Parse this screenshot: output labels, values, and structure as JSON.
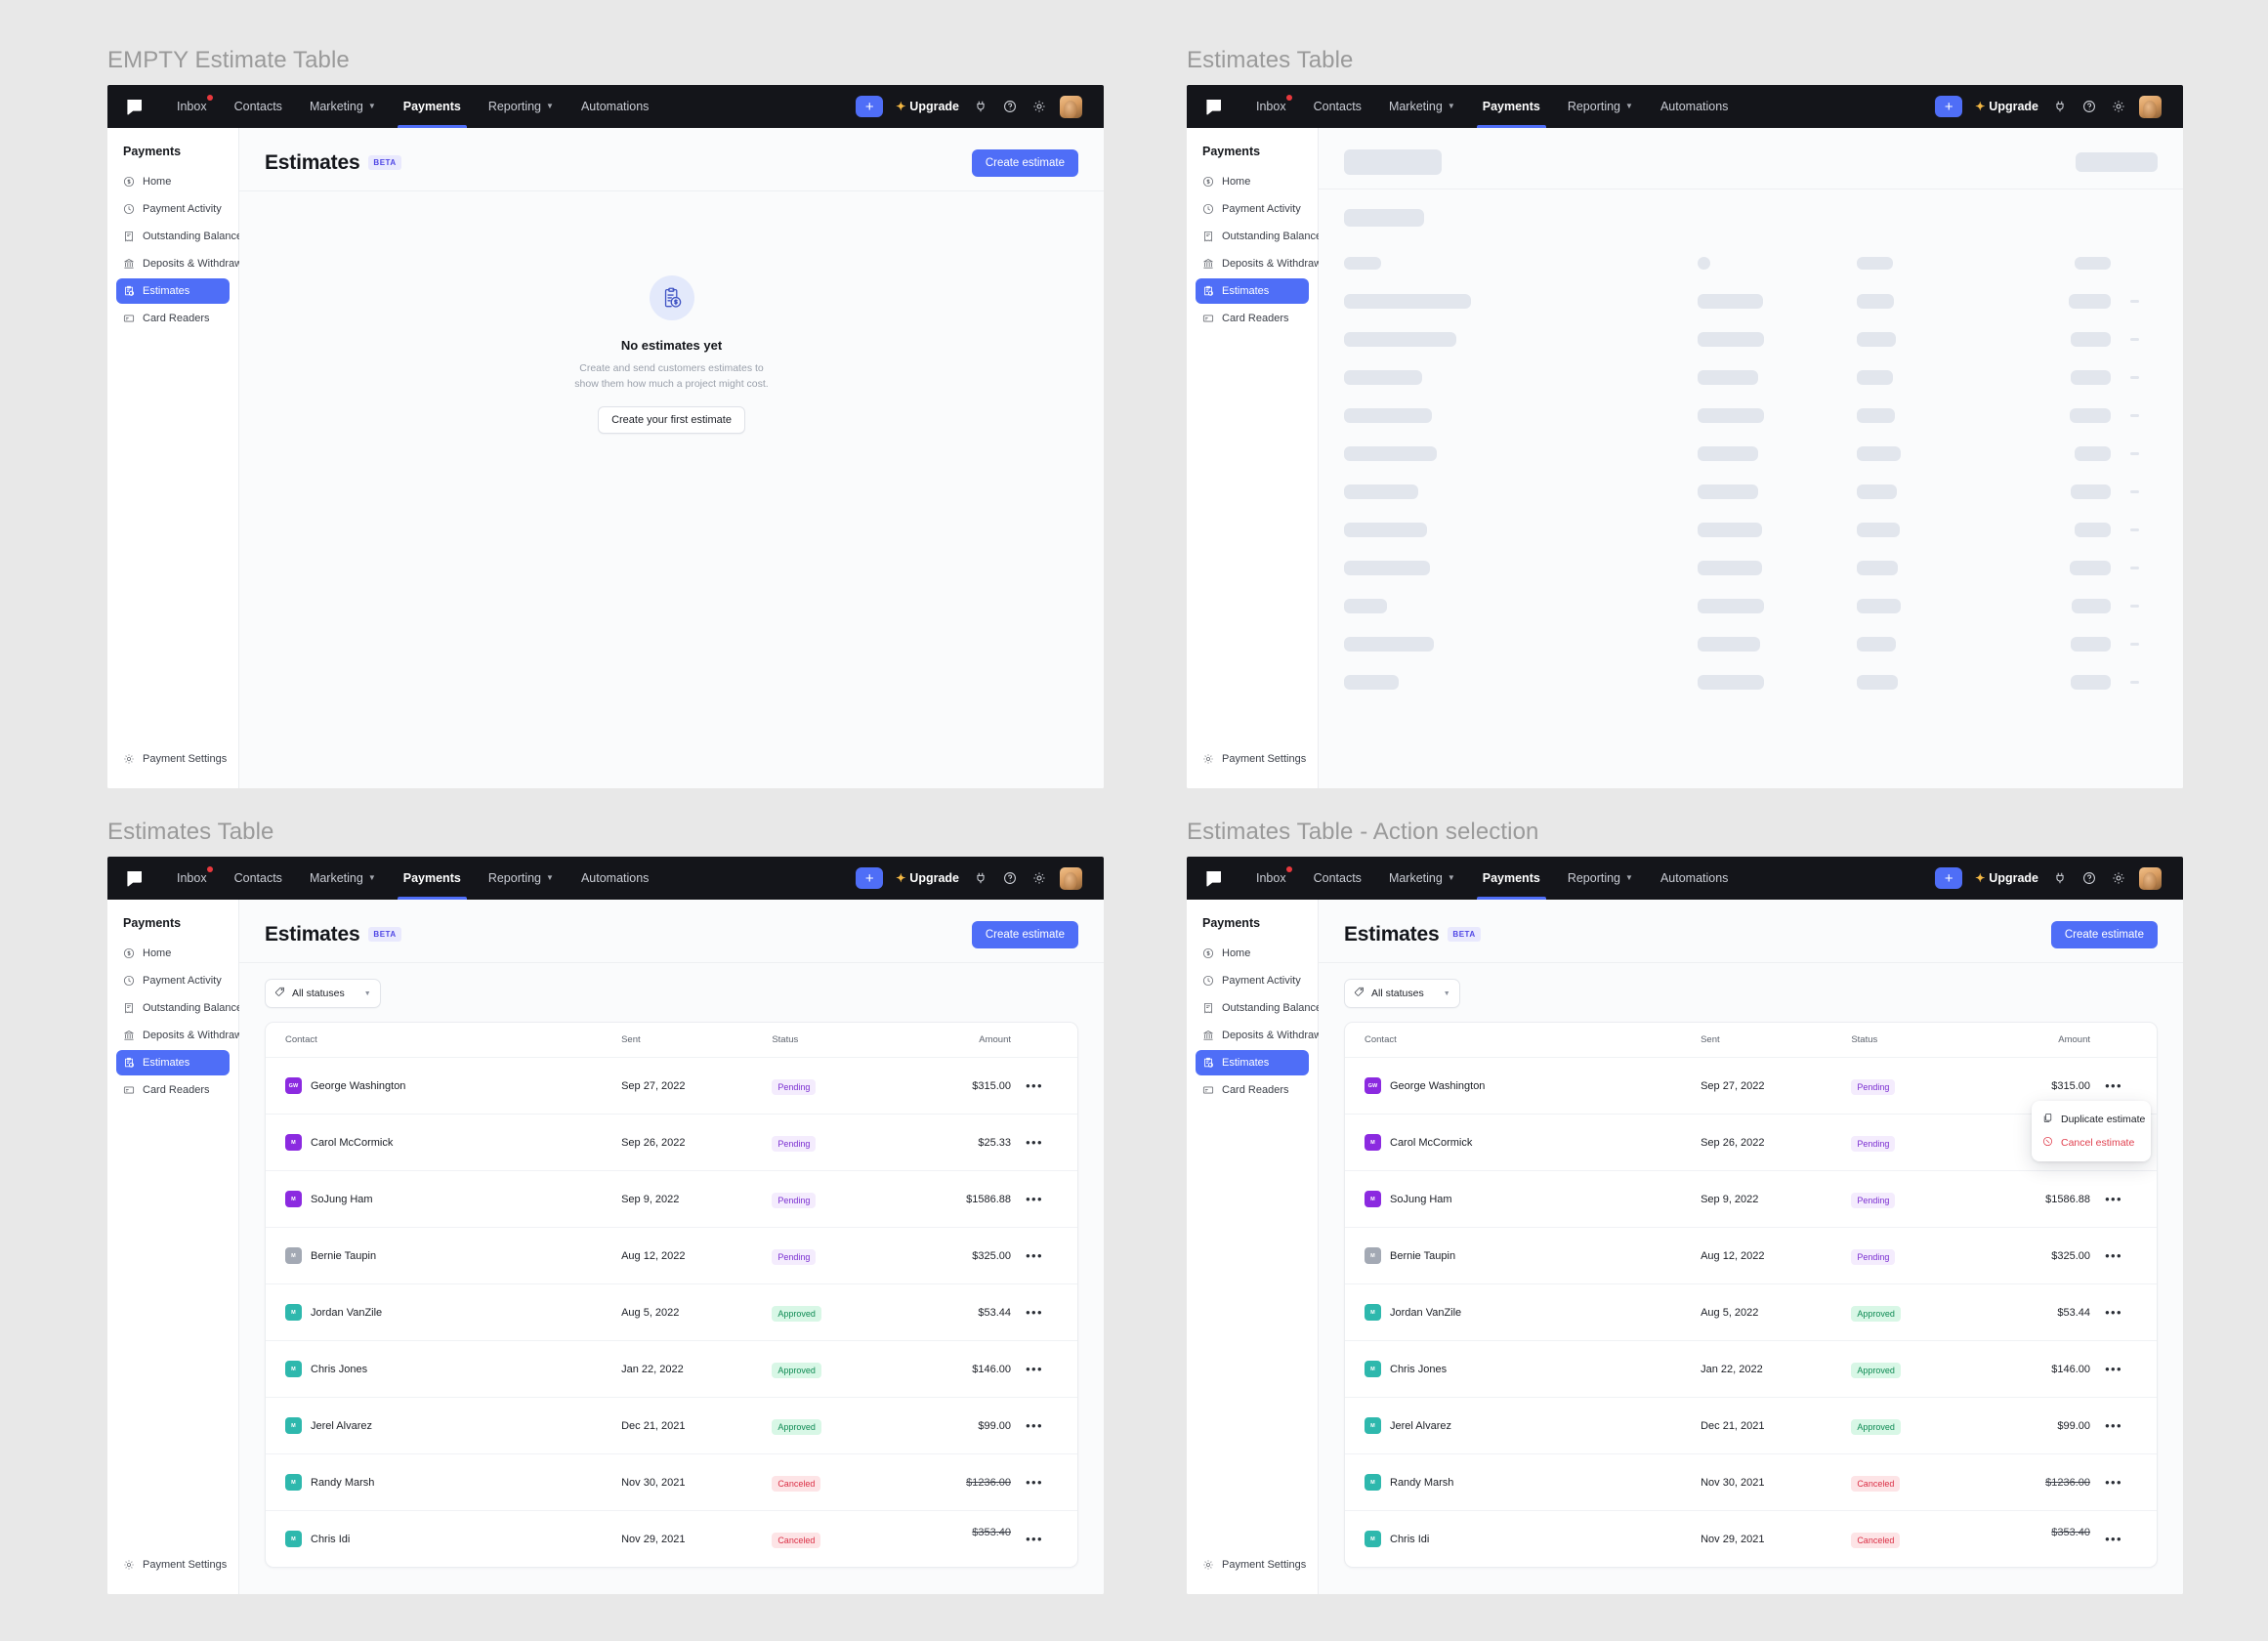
{
  "frames": [
    {
      "title": "EMPTY Estimate Table"
    },
    {
      "title": "Estimates Table"
    },
    {
      "title": "Estimates Table"
    },
    {
      "title": "Estimates Table - Action selection"
    }
  ],
  "topnav": {
    "links": [
      {
        "label": "Inbox",
        "has_dot": true,
        "has_caret": false,
        "active": false
      },
      {
        "label": "Contacts",
        "has_dot": false,
        "has_caret": false,
        "active": false
      },
      {
        "label": "Marketing",
        "has_dot": false,
        "has_caret": true,
        "active": false
      },
      {
        "label": "Payments",
        "has_dot": false,
        "has_caret": false,
        "active": true
      },
      {
        "label": "Reporting",
        "has_dot": false,
        "has_caret": true,
        "active": false
      },
      {
        "label": "Automations",
        "has_dot": false,
        "has_caret": false,
        "active": false
      }
    ],
    "plus_label": "+",
    "upgrade_label": "Upgrade",
    "icons": [
      "plug-icon",
      "help-circle-icon",
      "gear-icon",
      "avatar"
    ],
    "accent": "#4f6ef7",
    "background": "#14151a"
  },
  "sidebar": {
    "title": "Payments",
    "items": [
      {
        "label": "Home",
        "icon": "dollar-circle-icon",
        "active": false
      },
      {
        "label": "Payment Activity",
        "icon": "clock-icon",
        "active": false
      },
      {
        "label": "Outstanding Balances",
        "icon": "receipt-icon",
        "active": false
      },
      {
        "label": "Deposits & Withdrawals",
        "icon": "bank-icon",
        "active": false
      },
      {
        "label": "Estimates",
        "icon": "clipboard-dollar-icon",
        "active": true
      },
      {
        "label": "Card Readers",
        "icon": "card-reader-icon",
        "active": false
      }
    ],
    "footer": {
      "label": "Payment Settings",
      "icon": "gear-icon"
    }
  },
  "page": {
    "title": "Estimates",
    "beta_label": "BETA",
    "create_button": "Create estimate"
  },
  "empty_state": {
    "icon": "clipboard-dollar-icon",
    "heading": "No estimates yet",
    "description": "Create and send customers estimates to show them how much a project might cost.",
    "button": "Create your first estimate"
  },
  "filter": {
    "icon": "tag-icon",
    "label": "All statuses",
    "chevron": "chevron-down-icon"
  },
  "table": {
    "columns": [
      "Contact",
      "Sent",
      "Status",
      "Amount"
    ],
    "rows": [
      {
        "initials": "GW",
        "avatar_color": "#8b2ae0",
        "name": "George Washington",
        "sent": "Sep 27, 2022",
        "status": "Pending",
        "status_key": "pending",
        "amount": "$315.00",
        "struck": false
      },
      {
        "initials": "M",
        "avatar_color": "#8b2ae0",
        "name": "Carol McCormick",
        "sent": "Sep 26, 2022",
        "status": "Pending",
        "status_key": "pending",
        "amount": "$25.33",
        "struck": false
      },
      {
        "initials": "M",
        "avatar_color": "#8b2ae0",
        "name": "SoJung Ham",
        "sent": "Sep 9, 2022",
        "status": "Pending",
        "status_key": "pending",
        "amount": "$1586.88",
        "struck": false
      },
      {
        "initials": "M",
        "avatar_color": "#a3a9b4",
        "name": "Bernie Taupin",
        "sent": "Aug 12, 2022",
        "status": "Pending",
        "status_key": "pending",
        "amount": "$325.00",
        "struck": false
      },
      {
        "initials": "M",
        "avatar_color": "#2eb8ad",
        "name": "Jordan VanZile",
        "sent": "Aug 5, 2022",
        "status": "Approved",
        "status_key": "approved",
        "amount": "$53.44",
        "struck": false
      },
      {
        "initials": "M",
        "avatar_color": "#2eb8ad",
        "name": "Chris Jones",
        "sent": "Jan 22, 2022",
        "status": "Approved",
        "status_key": "approved",
        "amount": "$146.00",
        "struck": false
      },
      {
        "initials": "M",
        "avatar_color": "#2eb8ad",
        "name": "Jerel Alvarez",
        "sent": "Dec 21, 2021",
        "status": "Approved",
        "status_key": "approved",
        "amount": "$99.00",
        "struck": false
      },
      {
        "initials": "M",
        "avatar_color": "#2eb8ad",
        "name": "Randy Marsh",
        "sent": "Nov 30, 2021",
        "status": "Canceled",
        "status_key": "canceled",
        "amount": "$1236.00",
        "struck": true
      },
      {
        "initials": "M",
        "avatar_color": "#2eb8ad",
        "name": "Chris Idi",
        "sent": "Nov 29, 2021",
        "status": "Canceled",
        "status_key": "canceled",
        "amount": "$353.40",
        "struck": true
      }
    ],
    "row_menu_icon": "ellipsis-icon"
  },
  "action_menu": {
    "items": [
      {
        "label": "Duplicate estimate",
        "icon": "copy-icon",
        "danger": false
      },
      {
        "label": "Cancel estimate",
        "icon": "cancel-circle-icon",
        "danger": true
      }
    ]
  },
  "skeleton": {
    "rows": 12,
    "color": "#e2e6ed"
  },
  "colors": {
    "accent": "#4f6ef7",
    "nav_background": "#14151a",
    "pending": "#7b2fd1",
    "approved": "#0e8a53",
    "canceled": "#da2f45",
    "page_background": "#e8e8e8"
  }
}
